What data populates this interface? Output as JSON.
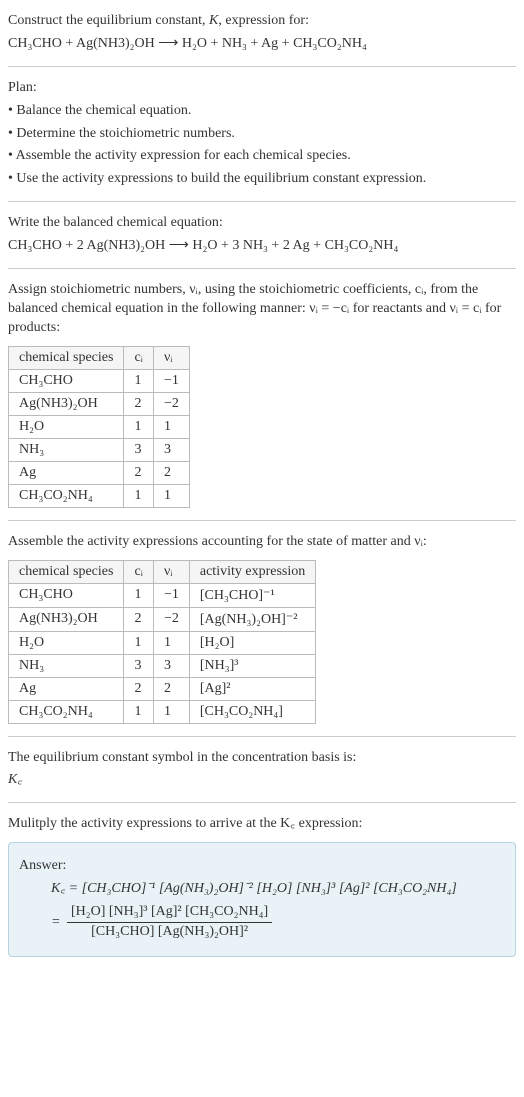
{
  "intro": {
    "line1": "Construct the equilibrium constant, K, expression for:",
    "eq": "CH₃CHO + Ag(NH3)₂OH ⟶ H₂O + NH₃ + Ag + CH₃CO₂NH₄"
  },
  "plan": {
    "heading": "Plan:",
    "b1": "• Balance the chemical equation.",
    "b2": "• Determine the stoichiometric numbers.",
    "b3": "• Assemble the activity expression for each chemical species.",
    "b4": "• Use the activity expressions to build the equilibrium constant expression."
  },
  "balanced": {
    "heading": "Write the balanced chemical equation:",
    "eq": "CH₃CHO + 2 Ag(NH3)₂OH ⟶ H₂O + 3 NH₃ + 2 Ag + CH₃CO₂NH₄"
  },
  "assign": {
    "text": "Assign stoichiometric numbers, νᵢ, using the stoichiometric coefficients, cᵢ, from the balanced chemical equation in the following manner: νᵢ = −cᵢ for reactants and νᵢ = cᵢ for products:"
  },
  "table1": {
    "h1": "chemical species",
    "h2": "cᵢ",
    "h3": "νᵢ",
    "rows": [
      {
        "s": "CH₃CHO",
        "c": "1",
        "v": "−1"
      },
      {
        "s": "Ag(NH3)₂OH",
        "c": "2",
        "v": "−2"
      },
      {
        "s": "H₂O",
        "c": "1",
        "v": "1"
      },
      {
        "s": "NH₃",
        "c": "3",
        "v": "3"
      },
      {
        "s": "Ag",
        "c": "2",
        "v": "2"
      },
      {
        "s": "CH₃CO₂NH₄",
        "c": "1",
        "v": "1"
      }
    ]
  },
  "assemble": {
    "text": "Assemble the activity expressions accounting for the state of matter and νᵢ:"
  },
  "table2": {
    "h1": "chemical species",
    "h2": "cᵢ",
    "h3": "νᵢ",
    "h4": "activity expression",
    "rows": [
      {
        "s": "CH₃CHO",
        "c": "1",
        "v": "−1",
        "a": "[CH₃CHO]⁻¹"
      },
      {
        "s": "Ag(NH3)₂OH",
        "c": "2",
        "v": "−2",
        "a": "[Ag(NH₃)₂OH]⁻²"
      },
      {
        "s": "H₂O",
        "c": "1",
        "v": "1",
        "a": "[H₂O]"
      },
      {
        "s": "NH₃",
        "c": "3",
        "v": "3",
        "a": "[NH₃]³"
      },
      {
        "s": "Ag",
        "c": "2",
        "v": "2",
        "a": "[Ag]²"
      },
      {
        "s": "CH₃CO₂NH₄",
        "c": "1",
        "v": "1",
        "a": "[CH₃CO₂NH₄]"
      }
    ]
  },
  "symbol": {
    "text": "The equilibrium constant symbol in the concentration basis is:",
    "k": "K꜀"
  },
  "multiply": {
    "text": "Mulitply the activity expressions to arrive at the K꜀ expression:"
  },
  "answer": {
    "label": "Answer:",
    "line1": "K꜀ = [CH₃CHO]⁻¹ [Ag(NH₃)₂OH]⁻² [H₂O] [NH₃]³ [Ag]² [CH₃CO₂NH₄]",
    "eq_prefix": "= ",
    "num": "[H₂O] [NH₃]³ [Ag]² [CH₃CO₂NH₄]",
    "den": "[CH₃CHO] [Ag(NH₃)₂OH]²"
  }
}
